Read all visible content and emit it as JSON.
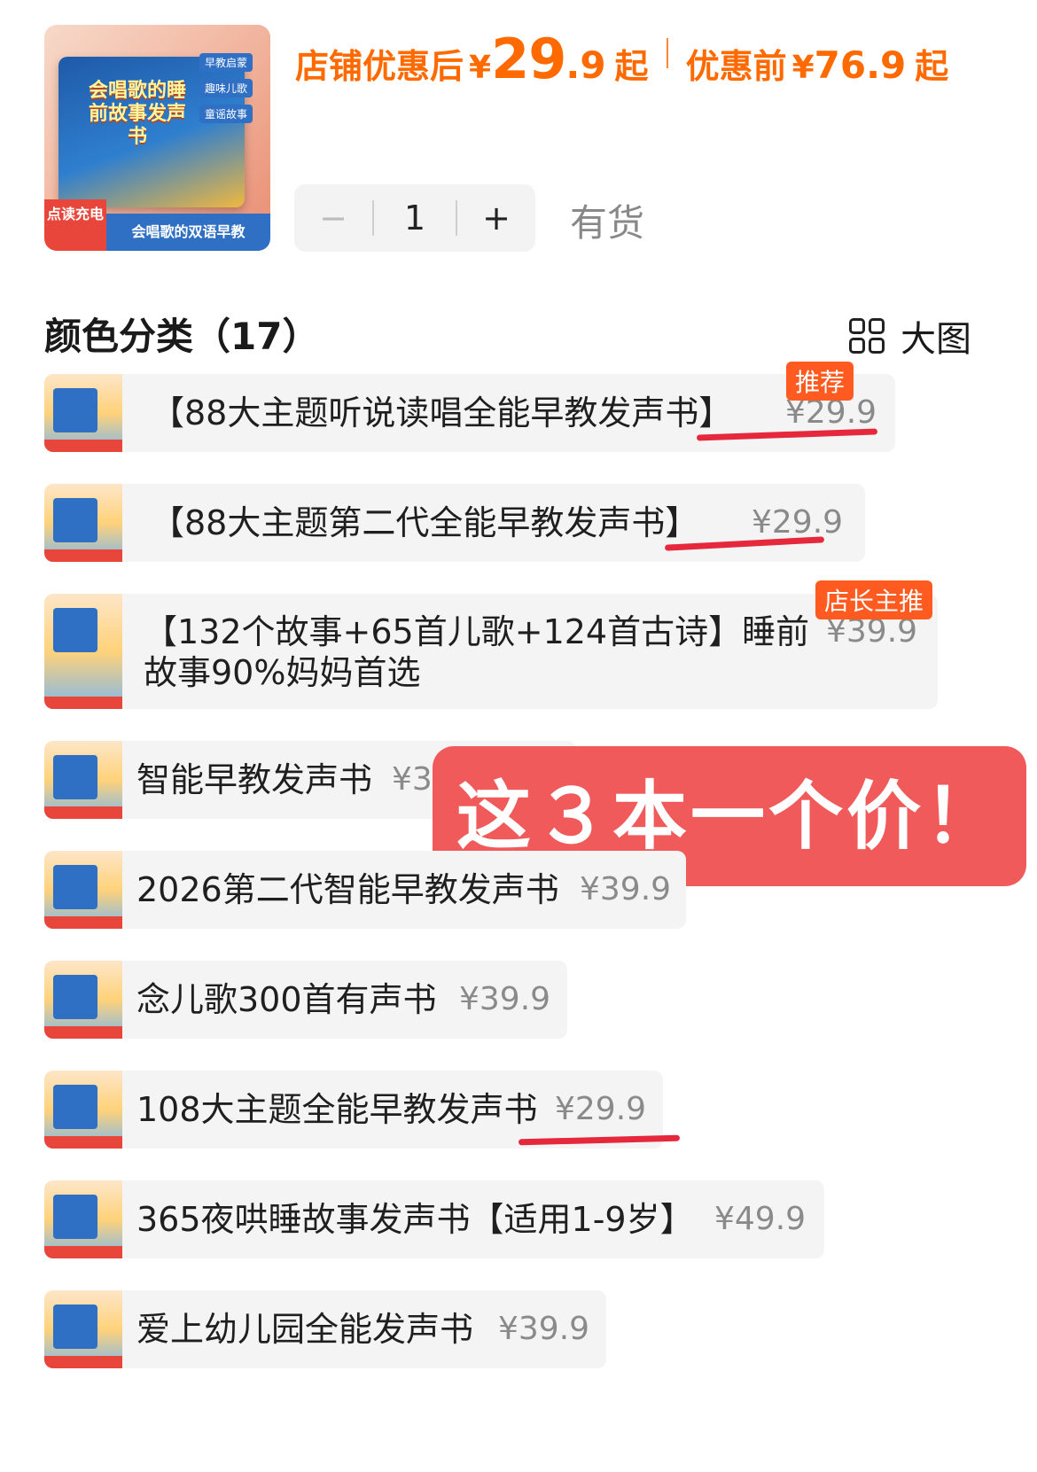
{
  "product": {
    "thumb_tags": [
      "早教启蒙",
      "趣味儿歌",
      "童谣故事"
    ],
    "thumb_title": "会唱歌的睡前故事发声书",
    "thumb_charge": "点读充电",
    "thumb_banner": "会唱歌的双语早教",
    "price_after_label": "店铺优惠后",
    "yen": "¥",
    "price_after_int": "29",
    "price_after_dec": ".9",
    "qi": "起",
    "price_before_label": "优惠前",
    "price_before": "76.9",
    "quantity": "1",
    "minus": "−",
    "plus": "+",
    "stock": "有货"
  },
  "section": {
    "title": "颜色分类（17）",
    "view_label": "大图"
  },
  "items": [
    {
      "name": "【88大主题听说读唱全能早教发声书】",
      "price": "¥29.9",
      "badge": "推荐"
    },
    {
      "name": "【88大主题第二代全能早教发声书】",
      "price": "¥29.9"
    },
    {
      "name_line1": "【132个故事+65首儿歌+124首古诗】睡前",
      "name_line2": "故事90%妈妈首选",
      "price": "¥39.9",
      "badge": "店长主推"
    },
    {
      "name": "智能早教发声书",
      "price": "¥39.9"
    },
    {
      "name": "2026第二代智能早教发声书",
      "price": "¥39.9"
    },
    {
      "name": "念儿歌300首有声书",
      "price": "¥39.9"
    },
    {
      "name": "108大主题全能早教发声书",
      "price": "¥29.9"
    },
    {
      "name": "365夜哄睡故事发声书【适用1-9岁】",
      "price": "¥49.9"
    },
    {
      "name": "爱上幼儿园全能发声书",
      "price": "¥39.9"
    }
  ],
  "callout": "这３本一个价！",
  "colors": {
    "accent": "#ff6a00",
    "underline": "#e6283c",
    "callout_bg": "#f15a5a"
  }
}
